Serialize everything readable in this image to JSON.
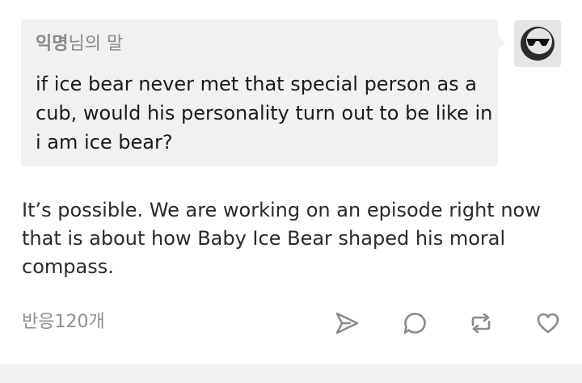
{
  "ask": {
    "asker_name": "익명",
    "asker_suffix": "님의 말",
    "question": "if ice bear never met that special person as a cub, would his personality turn out to be like in i am ice bear?",
    "avatar_icon": "sunglasses-face-icon"
  },
  "answer": {
    "text": "It’s possible. We are working on an episode right now that is about how Baby Ice Bear shaped his moral compass."
  },
  "footer": {
    "notes_label": "반응120개",
    "actions": [
      "share-icon",
      "reply-icon",
      "reblog-icon",
      "like-icon"
    ]
  },
  "colors": {
    "bubble_bg": "#f1f1f1",
    "icon_gray": "#8c8c8c",
    "page_bg": "#ffffff"
  }
}
